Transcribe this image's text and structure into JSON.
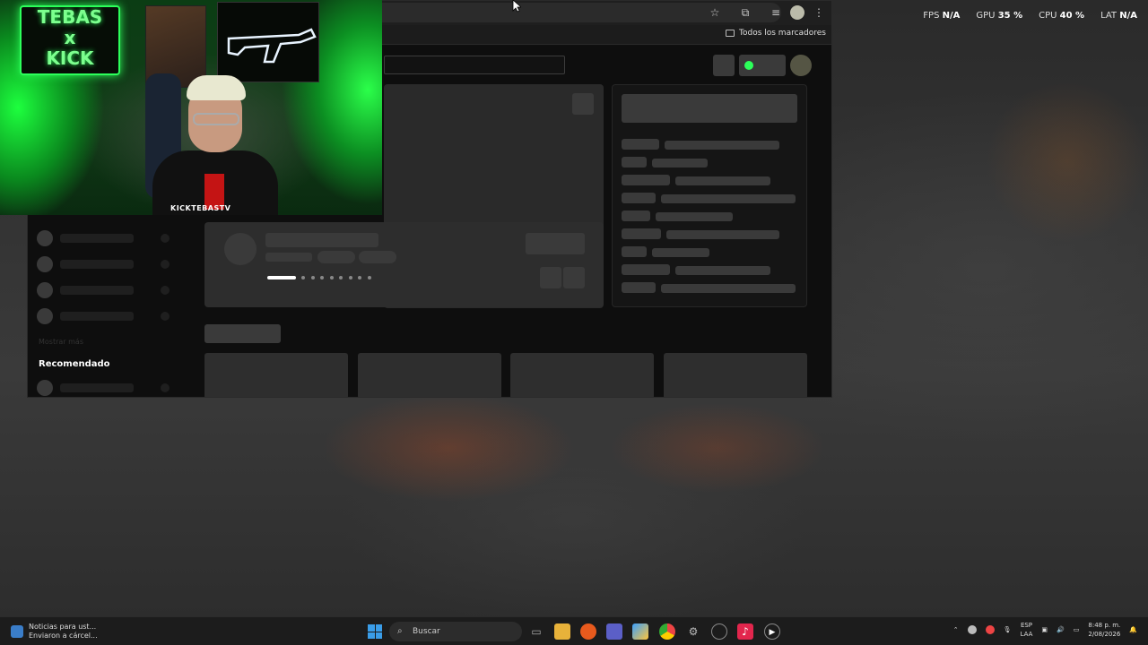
{
  "perf_overlay": {
    "fps_label": "FPS",
    "fps_value": "N/A",
    "gpu_label": "GPU",
    "gpu_value": "35 %",
    "cpu_label": "CPU",
    "cpu_value": "40 %",
    "lat_label": "LAT",
    "lat_value": "N/A"
  },
  "browser": {
    "bookmarks_label": "Todos los marcadores",
    "toolbar_icons": [
      "star-icon",
      "extensions-icon",
      "media-icon",
      "profile-icon",
      "menu-icon"
    ]
  },
  "page": {
    "sidebar_recommended": "Recomendado",
    "sidebar_more": "Mostrar más"
  },
  "webcam": {
    "sign_line1": "TEBAS",
    "sign_line2": "x",
    "sign_line3": "KICK",
    "channel_name": "KICKTEBASTV"
  },
  "taskbar": {
    "news_line1": "Noticias para ust...",
    "news_line2": "Enviaron a cárcel...",
    "search_placeholder": "Buscar",
    "lang_line1": "ESP",
    "lang_line2": "LAA",
    "time": "8:48 p. m.",
    "date": "2/08/2026",
    "apps": [
      "task-view-icon",
      "file-explorer-icon",
      "firefox-icon",
      "teams-icon",
      "copilot-icon",
      "chrome-icon",
      "settings-icon",
      "obs-icon",
      "tiktok-icon",
      "media-player-icon"
    ]
  },
  "colors": {
    "neon_green": "#2cff5a",
    "windows_blue": "#3a9de8"
  }
}
